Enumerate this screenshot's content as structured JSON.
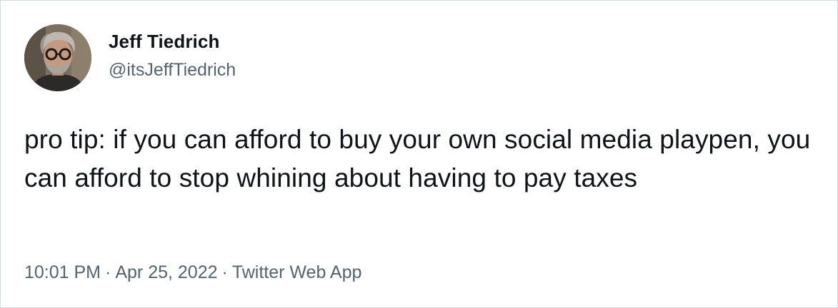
{
  "tweet": {
    "author": {
      "display_name": "Jeff Tiedrich",
      "handle": "@itsJeffTiedrich",
      "avatar_icon": "profile-photo"
    },
    "text": "pro tip: if you can afford to buy your own social media playpen, you can afford to stop whining about having to pay taxes",
    "time": "10:01 PM",
    "separator": "·",
    "date": "Apr 25, 2022",
    "source": "Twitter Web App"
  },
  "colors": {
    "text_primary": "#0f1419",
    "text_secondary": "#536471",
    "border": "#cfd9de",
    "background": "#ffffff"
  }
}
